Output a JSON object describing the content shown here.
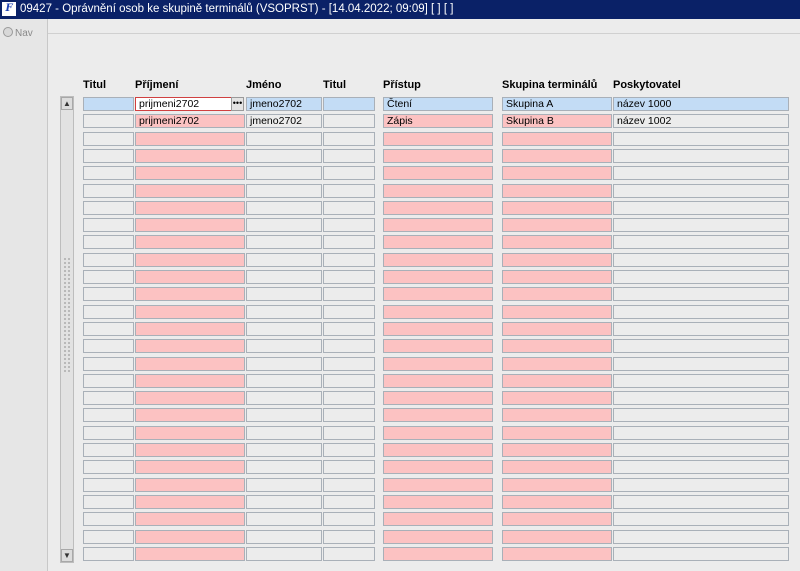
{
  "window": {
    "title": "09427 - Oprávnění osob ke skupině terminálů (VSOPRST) - [14.04.2022; 09:09]  [ ]  [ ]"
  },
  "nav": {
    "label": "Nav"
  },
  "columns": [
    "Titul",
    "Příjmení",
    "Jméno",
    "Titul",
    "Přístup",
    "Skupina terminálů",
    "Poskytovatel"
  ],
  "rows": [
    [
      "",
      "prijmeni2702",
      "jmeno2702",
      "",
      "Čtení",
      "Skupina A",
      "název 1000"
    ],
    [
      "",
      "prijmeni2702",
      "jmeno2702",
      "",
      "Zápis",
      "Skupina B",
      "název 1002"
    ]
  ],
  "lov_icon": "ellipsis-icon",
  "colors": {
    "required_field": "#fcc2c2",
    "selected_row": "#c3dcf5",
    "titlebar": "#0a2167"
  }
}
